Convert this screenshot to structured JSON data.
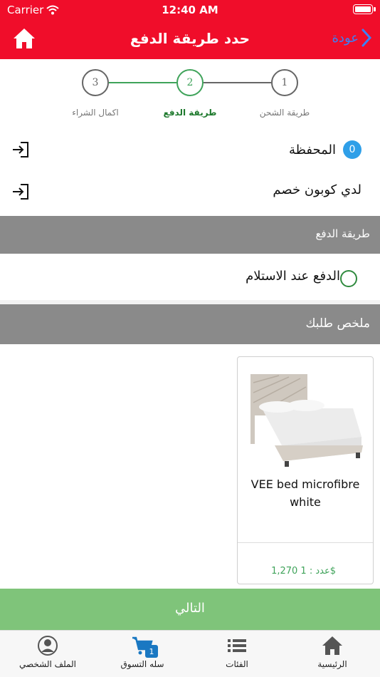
{
  "status_bar": {
    "carrier": "Carrier",
    "time": "12:40 AM"
  },
  "header": {
    "title": "حدد طريقة الدفع",
    "back_label": "عودة"
  },
  "stepper": {
    "steps": [
      {
        "number": "1",
        "label": "طريقة الشحن",
        "state": "done"
      },
      {
        "number": "2",
        "label": "طريقة الدفع",
        "state": "active"
      },
      {
        "number": "3",
        "label": "اكمال الشراء",
        "state": "pending"
      }
    ]
  },
  "wallet": {
    "label": "المحفظة",
    "balance": "0"
  },
  "coupon": {
    "label": "لدي كوبون خصم"
  },
  "payment_section": {
    "title": "طريقة الدفع",
    "option_label": "الدفع عند الاستلام",
    "selected": false
  },
  "summary_section": {
    "title": "ملخص طلبك"
  },
  "product": {
    "name": "VEE bed microfibre white",
    "price": "1,270$",
    "qty_label": "عدد : 1"
  },
  "next_button": {
    "label": "التالي"
  },
  "tabbar": {
    "items": [
      {
        "label": "الرئيسية",
        "icon": "home-icon"
      },
      {
        "label": "الفئات",
        "icon": "list-icon"
      },
      {
        "label": "سله التسوق",
        "icon": "cart-icon",
        "badge": "1"
      },
      {
        "label": "الملف الشخصي",
        "icon": "profile-icon"
      }
    ]
  },
  "colors": {
    "brand_red": "#f00d2a",
    "accent_green": "#3fa35a",
    "next_button": "#7fc47a",
    "section_gray": "#8a8a8a",
    "link_blue": "#3b82f6"
  }
}
